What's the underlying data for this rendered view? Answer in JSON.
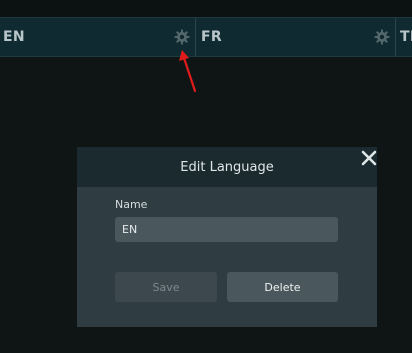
{
  "language_bar": {
    "columns": [
      {
        "code": "EN",
        "icon": "gear-icon"
      },
      {
        "code": "FR",
        "icon": "gear-icon"
      },
      {
        "code": "TH",
        "icon": ""
      }
    ]
  },
  "annotation": {
    "icon": "arrow-icon",
    "color": "#e01b1b"
  },
  "modal": {
    "title": "Edit Language",
    "close_icon": "close-icon",
    "name_label": "Name",
    "name_value": "EN",
    "save_label": "Save",
    "delete_label": "Delete"
  },
  "colors": {
    "background": "#0f1515",
    "header_bar": "#0f2b31",
    "modal_body": "#2f3c41",
    "modal_header": "#1a2a2f",
    "input_bg": "#4a575c",
    "button_bg": "#4a575c",
    "disabled_button_bg": "#3c484d"
  }
}
